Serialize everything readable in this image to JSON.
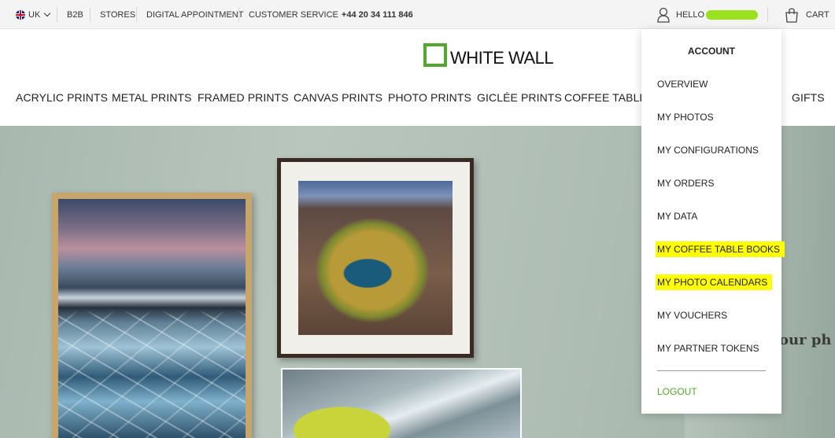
{
  "topbar": {
    "region": "UK",
    "links": [
      "B2B",
      "STORES",
      "DIGITAL APPOINTMENT"
    ],
    "customer_service_label": "CUSTOMER SERVICE",
    "customer_service_phone": "+44 20 34 111 846",
    "hello_label": "HELLO",
    "cart_label": "CART"
  },
  "header": {
    "logo_text": "WHITE WALL",
    "nav": [
      "ACRYLIC PRINTS",
      "METAL PRINTS",
      "FRAMED PRINTS",
      "CANVAS PRINTS",
      "PHOTO PRINTS",
      "GICLÉE PRINTS",
      "COFFEE TABLE B",
      "GIFTS"
    ]
  },
  "hero": {
    "partial_text": "our ph"
  },
  "account_menu": {
    "title": "ACCOUNT",
    "items": [
      "OVERVIEW",
      "MY PHOTOS",
      "MY CONFIGURATIONS",
      "MY ORDERS",
      "MY DATA",
      "MY COFFEE TABLE BOOKS",
      "MY PHOTO CALENDARS",
      "MY VOUCHERS",
      "MY PARTNER TOKENS"
    ],
    "highlighted": [
      "MY COFFEE TABLE BOOKS",
      "MY PHOTO CALENDARS"
    ],
    "logout": "LOGOUT"
  },
  "colors": {
    "brand_green": "#55a630",
    "highlight": "#ffff00",
    "username_redaction": "#9be11f"
  },
  "icons": [
    "uk-flag-icon",
    "chevron-down-icon",
    "user-icon",
    "cart-icon"
  ]
}
